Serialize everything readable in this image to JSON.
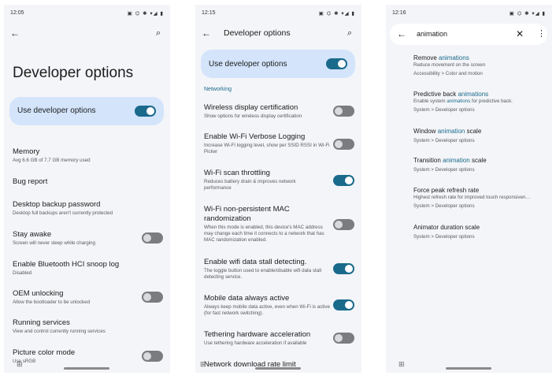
{
  "screen1": {
    "time": "12:05",
    "status_icons": "▣ ⌬ ✱ ▾◢ ▮",
    "title": "Developer options",
    "use_dev_options_label": "Use developer options",
    "items": [
      {
        "title": "Memory",
        "subtitle": "Avg 6.6 GB of 7.7 GB memory used"
      },
      {
        "title": "Bug report",
        "subtitle": ""
      },
      {
        "title": "Desktop backup password",
        "subtitle": "Desktop full backups aren't currently protected"
      },
      {
        "title": "Stay awake",
        "subtitle": "Screen will never sleep while charging"
      },
      {
        "title": "Enable Bluetooth HCI snoop log",
        "subtitle": "Disabled"
      },
      {
        "title": "OEM unlocking",
        "subtitle": "Allow the bootloader to be unlocked"
      },
      {
        "title": "Running services",
        "subtitle": "View and control currently running services"
      },
      {
        "title": "Picture color mode",
        "subtitle": "Use sRGB"
      }
    ]
  },
  "screen2": {
    "time": "12:15",
    "status_icons": "▣ ⌬ ✱ ▾◢ ▮",
    "title": "Developer options",
    "use_dev_options_label": "Use developer options",
    "section": "Networking",
    "items": [
      {
        "title": "Wireless display certification",
        "subtitle": "Show options for wireless display certification"
      },
      {
        "title": "Enable Wi-Fi Verbose Logging",
        "subtitle": "Increase Wi-Fi logging level, show per SSID RSSI in Wi-Fi Picker"
      },
      {
        "title": "Wi-Fi scan throttling",
        "subtitle": "Reduces battery drain & improves network performance"
      },
      {
        "title": "Wi-Fi non-persistent MAC randomization",
        "subtitle": "When this mode is enabled, this device's MAC address may change each time it connects to a network that has MAC randomization enabled."
      },
      {
        "title": "Enable wifi data stall detecting.",
        "subtitle": "The toggle button used to enable/disable wifi data stall detecting service."
      },
      {
        "title": "Mobile data always active",
        "subtitle": "Always keep mobile data active, even when Wi-Fi is active (for fast network switching)."
      },
      {
        "title": "Tethering hardware acceleration",
        "subtitle": "Use tethering hardware acceleration if available"
      },
      {
        "title": "Network download rate limit",
        "subtitle": ""
      }
    ]
  },
  "screen3": {
    "time": "12:16",
    "status_icons": "▣ ⌬ ✱ ▾◢ ▮",
    "query": "animation",
    "results": [
      {
        "pre": "Remove ",
        "hl": "animations",
        "post": "",
        "subtitle": "Reduce movement on the screen",
        "path": "Accessibility > Color and motion"
      },
      {
        "pre": "Predictive back ",
        "hl": "animations",
        "post": "",
        "subtitle_pre": "Enable system ",
        "subtitle_hl": "animations",
        "subtitle_post": " for predictive back.",
        "path": "System > Developer options"
      },
      {
        "pre": "Window ",
        "hl": "animation",
        "post": " scale",
        "subtitle": "",
        "path": "System > Developer options"
      },
      {
        "pre": "Transition ",
        "hl": "animation",
        "post": " scale",
        "subtitle": "",
        "path": "System > Developer options"
      },
      {
        "pre": "Force peak refresh rate",
        "hl": "",
        "post": "",
        "subtitle": "Highest refresh rate for improved touch responsiven…",
        "path": "System > Developer options"
      },
      {
        "pre": "Animator duration scale",
        "hl": "",
        "post": "",
        "subtitle": "",
        "path": "System > Developer options"
      }
    ]
  },
  "colors": {
    "accent": "#1a6a8c",
    "highlight_card": "#d3e4fb",
    "background": "#f4f5f8"
  }
}
